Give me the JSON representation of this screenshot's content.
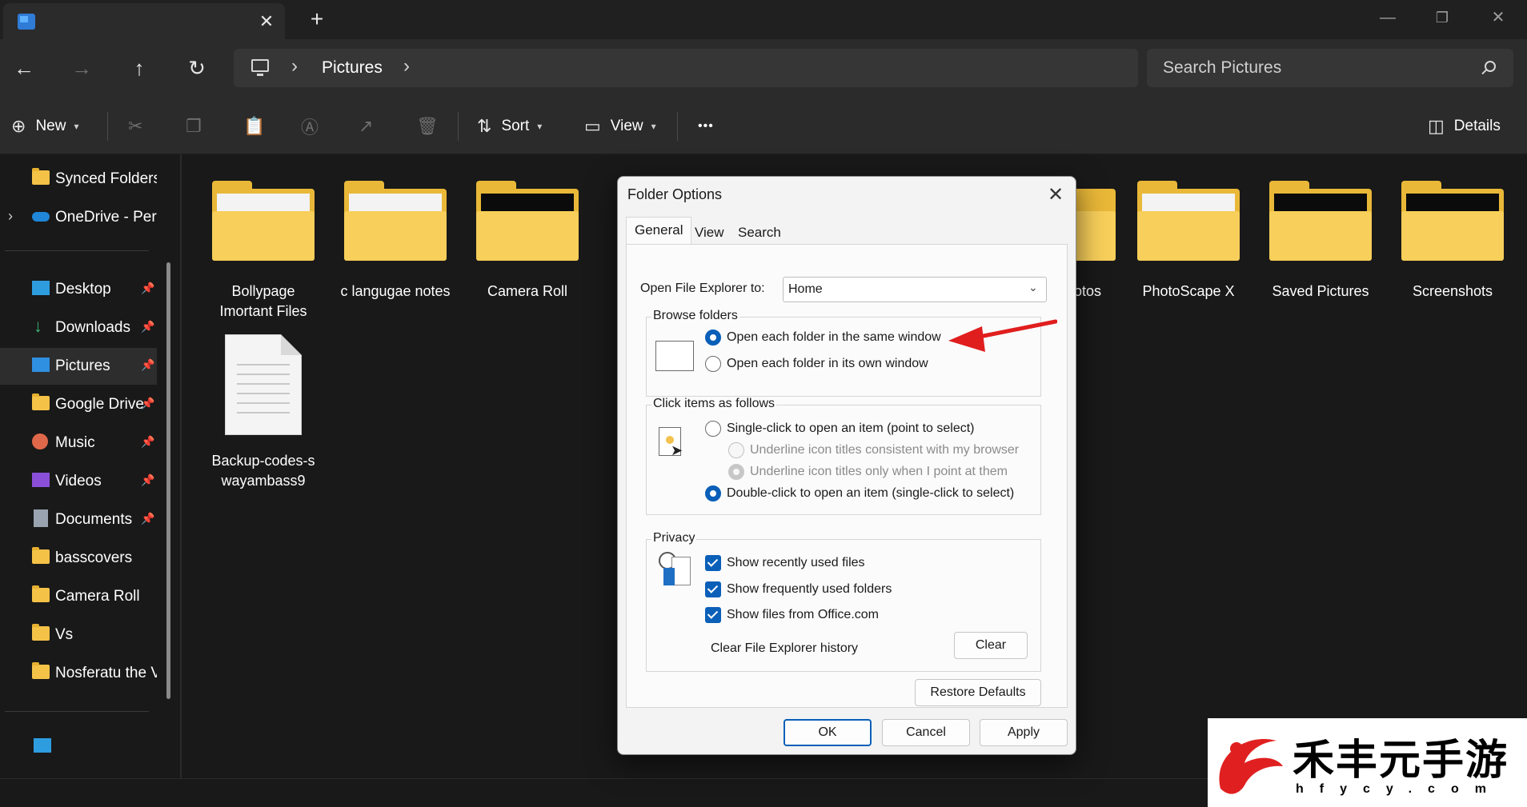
{
  "colors": {
    "accent": "#0a5fb8",
    "folder": "#f4c247",
    "arrow": "#e01e1e",
    "dark_bg": "#191919"
  },
  "window": {
    "tab_close_glyph": "✕",
    "new_tab_glyph": "+",
    "minimize_glyph": "—",
    "restore_glyph": "❐",
    "close_glyph": "✕"
  },
  "addressbar": {
    "crumbs": [
      "Pictures"
    ],
    "chevron_glyph": "›",
    "search_placeholder": "Search Pictures"
  },
  "nav_glyphs": {
    "back": "←",
    "forward": "→",
    "up": "↑",
    "refresh": "↻"
  },
  "commandbar": {
    "new_label": "New",
    "sort_label": "Sort",
    "view_label": "View",
    "more_glyph": "•••",
    "details_label": "Details"
  },
  "sidebar": {
    "items": [
      {
        "label": "Synced Folders",
        "icon": "folder-icon"
      },
      {
        "label": "OneDrive - Perso",
        "icon": "onedrive-icon"
      },
      {
        "label": "Desktop",
        "icon": "desktop-icon"
      },
      {
        "label": "Downloads",
        "icon": "download-icon"
      },
      {
        "label": "Pictures",
        "icon": "pictures-icon"
      },
      {
        "label": "Google Drive",
        "icon": "folder-icon"
      },
      {
        "label": "Music",
        "icon": "music-icon"
      },
      {
        "label": "Videos",
        "icon": "videos-icon"
      },
      {
        "label": "Documents",
        "icon": "documents-icon"
      },
      {
        "label": "basscovers",
        "icon": "folder-icon"
      },
      {
        "label": "Camera Roll",
        "icon": "folder-icon"
      },
      {
        "label": "Vs",
        "icon": "folder-icon"
      },
      {
        "label": "Nosferatu the Va",
        "icon": "folder-icon"
      }
    ],
    "pin_glyph": "📌",
    "expand_glyph": "›"
  },
  "files": [
    {
      "name": "Bollypage Imortant Files",
      "type": "folder"
    },
    {
      "name": "c langugae notes",
      "type": "folder"
    },
    {
      "name": "Camera Roll",
      "type": "folder"
    },
    {
      "name": "otos",
      "type": "folder"
    },
    {
      "name": "PhotoScape X",
      "type": "folder"
    },
    {
      "name": "Saved Pictures",
      "type": "folder"
    },
    {
      "name": "Screenshots",
      "type": "folder"
    },
    {
      "name": "Backup-codes-swayambass9",
      "type": "document"
    }
  ],
  "dialog": {
    "title": "Folder Options",
    "close_glyph": "✕",
    "tabs": [
      "General",
      "View",
      "Search"
    ],
    "open_to_label": "Open File Explorer to:",
    "open_to_value": "Home",
    "caret_glyph": "⌄",
    "browse": {
      "title": "Browse folders",
      "same_window": "Open each folder in the same window",
      "own_window": "Open each folder in its own window"
    },
    "click": {
      "title": "Click items as follows",
      "single": "Single-click to open an item (point to select)",
      "underline_browser": "Underline icon titles consistent with my browser",
      "underline_point": "Underline icon titles only when I point at them",
      "double": "Double-click to open an item (single-click to select)"
    },
    "privacy": {
      "title": "Privacy",
      "recent_files": "Show recently used files",
      "frequent_folders": "Show frequently used folders",
      "office_files": "Show files from Office.com",
      "clear_history_label": "Clear File Explorer history",
      "clear_button": "Clear"
    },
    "restore_defaults": "Restore Defaults",
    "ok": "OK",
    "cancel": "Cancel",
    "apply": "Apply"
  },
  "watermark": {
    "name": "禾丰元手游",
    "site": "hfycy.com"
  }
}
